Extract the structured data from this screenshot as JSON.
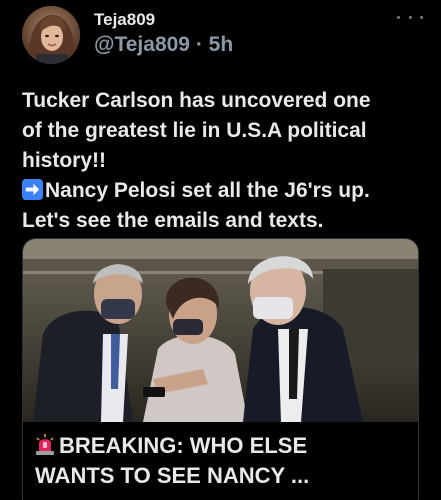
{
  "author": {
    "display_name": "Teja809",
    "handle": "@Teja809",
    "separator": "·",
    "time_ago": "5h",
    "avatar_icon": "profile-photo"
  },
  "tweet": {
    "lines": [
      "Tucker Carlson has uncovered one",
      "of the greatest lie in U.S.A political",
      "history!!"
    ],
    "arrow_icon": "right-arrow-emoji",
    "arrow_lines": [
      "Nancy Pelosi set all the J6'rs up.",
      "Let's see the emails and texts."
    ]
  },
  "card": {
    "image_icon": "news-photo",
    "siren_icon": "siren-emoji",
    "title_lines": [
      "BREAKING: WHO ELSE",
      "WANTS TO SEE NANCY ..."
    ]
  },
  "colors": {
    "background": "#000000",
    "text": "#e7e9ea",
    "secondary": "#8b98a5",
    "border": "#2f3336",
    "arrow_blue": "#3b82f6",
    "siren_red": "#e0245e"
  }
}
